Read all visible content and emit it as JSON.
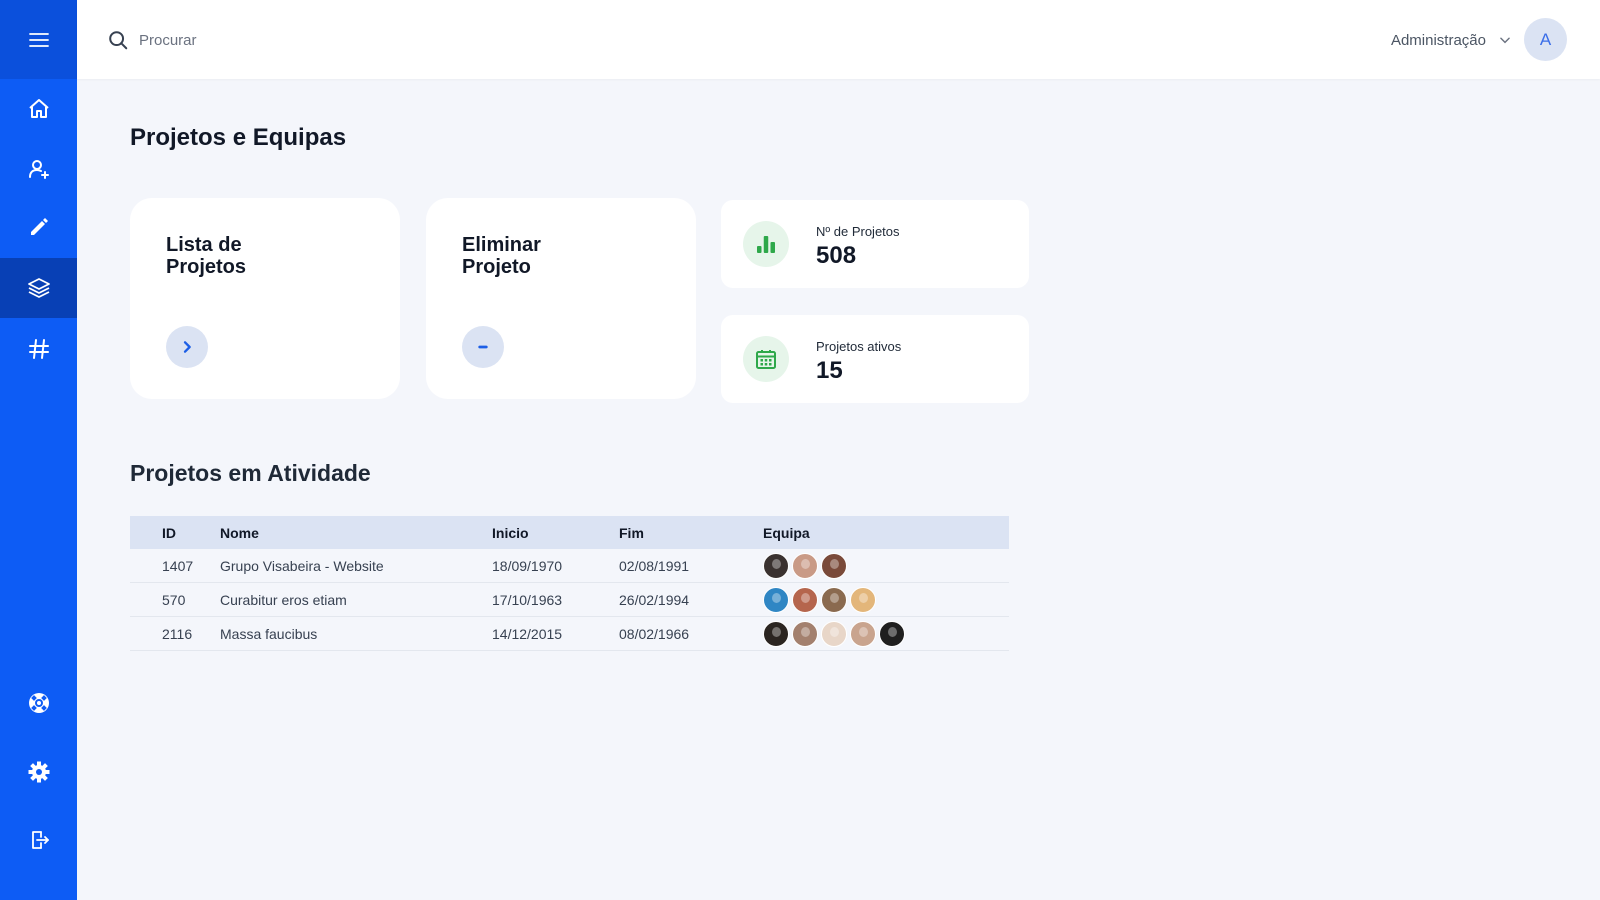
{
  "search": {
    "placeholder": "Procurar"
  },
  "header": {
    "admin_label": "Administração",
    "avatar_initial": "A"
  },
  "page": {
    "title": "Projetos e Equipas"
  },
  "cards": {
    "list": {
      "title": "Lista de Projetos"
    },
    "delete": {
      "title": "Eliminar Projeto"
    }
  },
  "stats": {
    "total": {
      "label": "Nº de Projetos",
      "value": "508"
    },
    "active": {
      "label": "Projetos ativos",
      "value": "15"
    }
  },
  "section": {
    "title": "Projetos em Atividade"
  },
  "table": {
    "headers": {
      "id": "ID",
      "nome": "Nome",
      "inicio": "Inicio",
      "fim": "Fim",
      "equipa": "Equipa"
    },
    "rows": [
      {
        "id": "1407",
        "nome": "Grupo Visabeira - Website",
        "inicio": "18/09/1970",
        "fim": "02/08/1991",
        "team": [
          "#3a3230",
          "#c99a86",
          "#7a4a3a"
        ]
      },
      {
        "id": "570",
        "nome": "Curabitur eros etiam",
        "inicio": "17/10/1963",
        "fim": "26/02/1994",
        "team": [
          "#2f86c4",
          "#b5654d",
          "#8a6a4f",
          "#e3b67a"
        ]
      },
      {
        "id": "2116",
        "nome": "Massa faucibus",
        "inicio": "14/12/2015",
        "fim": "08/02/1966",
        "team": [
          "#2b2521",
          "#a3806e",
          "#e8d6c8",
          "#c9a48e",
          "#1f1f1f"
        ]
      }
    ]
  },
  "colors": {
    "sidebar": "#0d5cf5",
    "sidebar_active": "#0840b5",
    "accent_green": "#2ea84a",
    "accent_blue": "#1d5fe6"
  }
}
